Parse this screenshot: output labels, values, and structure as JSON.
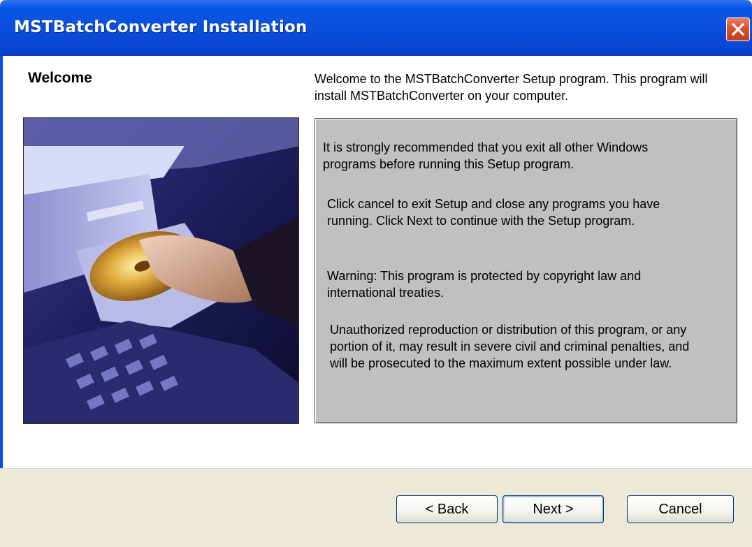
{
  "window": {
    "title": "MSTBatchConverter Installation"
  },
  "page": {
    "heading": "Welcome",
    "intro": "Welcome to the MSTBatchConverter Setup program. This program will install MSTBatchConverter on your computer."
  },
  "info": {
    "p1": "It is strongly recommended that you exit all other Windows programs before running this Setup program.",
    "p2": "Click cancel to exit Setup and close any programs you have running. Click Next to continue with the Setup program.",
    "p3": "Warning: This program is protected by copyright law and international treaties.",
    "p4": "Unauthorized reproduction or distribution of this program, or any portion of it, may result in severe civil and criminal penalties, and will be prosecuted to the maximum extent possible under law."
  },
  "buttons": {
    "back": "< Back",
    "next": "Next >",
    "cancel": "Cancel"
  },
  "icons": {
    "close": "close-x-icon"
  },
  "colors": {
    "titlebar": "#0a4fdc",
    "close_button": "#d7522f",
    "infobox_bg": "#c0c0c0",
    "footer_bg": "#ece9d8"
  }
}
